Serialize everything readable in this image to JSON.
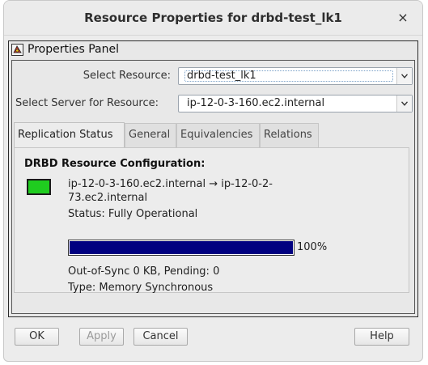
{
  "window": {
    "title": "Resource Properties for drbd-test_lk1",
    "close_glyph": "×"
  },
  "panel": {
    "header": "Properties Panel",
    "header_icon": "properties-panel-icon"
  },
  "fields": {
    "select_resource_label": "Select Resource:",
    "select_resource_value": "drbd-test_lk1",
    "select_server_label": "Select Server for Resource:",
    "select_server_value": "ip-12-0-3-160.ec2.internal"
  },
  "tabs": [
    {
      "label": "Replication Status",
      "active": true
    },
    {
      "label": "General",
      "active": false
    },
    {
      "label": "Equivalencies",
      "active": false
    },
    {
      "label": "Relations",
      "active": false
    }
  ],
  "replication": {
    "heading": "DRBD Resource Configuration:",
    "path_line1": "ip-12-0-3-160.ec2.internal → ip-12-0-2-",
    "path_line2": "73.ec2.internal",
    "status": "Status: Fully Operational",
    "progress_value": 100,
    "progress_label": "100%",
    "sync_info": "Out-of-Sync 0 KB, Pending: 0",
    "type": "Type: Memory Synchronous",
    "status_color": "#1fcc1f",
    "progress_color": "#000080"
  },
  "buttons": {
    "ok": "OK",
    "apply": "Apply",
    "cancel": "Cancel",
    "help": "Help"
  }
}
